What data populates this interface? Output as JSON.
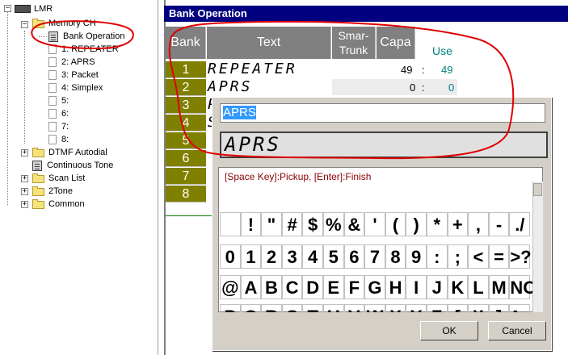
{
  "tree": {
    "root": "LMR",
    "memory_ch": "Memory CH",
    "items": [
      {
        "label": "Bank Operation"
      },
      {
        "label": "1: REPEATER"
      },
      {
        "label": "2: APRS"
      },
      {
        "label": "3: Packet"
      },
      {
        "label": "4: Simplex"
      },
      {
        "label": "5:"
      },
      {
        "label": "6:"
      },
      {
        "label": "7:"
      },
      {
        "label": "8:"
      }
    ],
    "dtmf": "DTMF Autodial",
    "continuous": "Continuous Tone",
    "scanlist": "Scan List",
    "twotone": "2Tone",
    "common": "Common"
  },
  "header": {
    "title": "Bank Operation"
  },
  "grid": {
    "col_bank": "Bank",
    "col_text": "Text",
    "col_smar": "Smar-\nTrunk",
    "col_capa": "Capa",
    "col_use": "Use",
    "rows": [
      {
        "bank": "1",
        "text": "REPEATER",
        "capa": "49",
        "sep": ":",
        "use": "49"
      },
      {
        "bank": "2",
        "text": "APRS",
        "capa": "0",
        "sep": ":",
        "use": "0"
      },
      {
        "bank": "3",
        "text": "P"
      },
      {
        "bank": "4",
        "text": "S"
      },
      {
        "bank": "5",
        "text": ""
      },
      {
        "bank": "6",
        "text": ""
      },
      {
        "bank": "7",
        "text": ""
      },
      {
        "bank": "8",
        "text": ""
      }
    ]
  },
  "dialog": {
    "input_value": "APRS",
    "lcd_value": "APRS",
    "hint": "[Space Key]:Pickup, [Enter]:Finish",
    "char_rows": [
      [
        " ",
        "!",
        "\"",
        "#",
        "$",
        "%",
        "&",
        "'",
        "(",
        ")",
        "*",
        "+",
        ",",
        "-",
        "./"
      ],
      [
        "0",
        "1",
        "2",
        "3",
        "4",
        "5",
        "6",
        "7",
        "8",
        "9",
        ":",
        ";",
        "<",
        "=",
        ">?"
      ],
      [
        "@",
        "A",
        "B",
        "C",
        "D",
        "E",
        "F",
        "G",
        "H",
        "I",
        "J",
        "K",
        "L",
        "M",
        "NO"
      ],
      [
        "P",
        "Q",
        "R",
        "S",
        "T",
        "U",
        "V",
        "W",
        "X",
        "Y",
        "Z",
        "[",
        "¥",
        "]",
        "^_"
      ]
    ],
    "ok_label": "OK",
    "cancel_label": "Cancel"
  },
  "colors": {
    "header_bg": "#000080",
    "bank_cell": "#808000",
    "header_cell": "#808080",
    "annotation": "#e00000",
    "use_text": "#008080"
  }
}
